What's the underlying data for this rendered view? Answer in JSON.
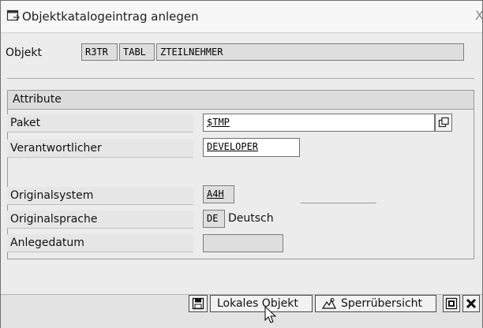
{
  "dialog": {
    "title": "Objektkatalogeintrag anlegen",
    "close_glyph": "X"
  },
  "object_row": {
    "label": "Objekt",
    "pgmid": "R3TR",
    "type": "TABL",
    "name": "ZTEILNEHMER"
  },
  "attributes": {
    "header": "Attribute",
    "paket_label": "Paket",
    "paket_value": "$TMP",
    "verantwortlicher_label": "Verantwortlicher",
    "verantwortlicher_value": "DEVELOPER",
    "originalsystem_label": "Originalsystem",
    "originalsystem_value": "A4H",
    "originalsprache_label": "Originalsprache",
    "originalsprache_code": "DE",
    "originalsprache_text": "Deutsch",
    "anlegedatum_label": "Anlegedatum",
    "anlegedatum_value": ""
  },
  "buttons": {
    "lokales_objekt": "Lokales Objekt",
    "sperruebersicht": "Sperrübersicht"
  },
  "icons": {
    "title": "dialog-icon",
    "save": "save-icon",
    "lock": "lock-overview-icon",
    "search_help": "search-help-icon",
    "help": "info-icon",
    "cancel": "cancel-icon"
  },
  "colors": {
    "dialog_bg": "#ececec",
    "group_header_bg": "#dcdcdc",
    "field_bg": "#ffffff",
    "readonly_bg": "#dedede"
  }
}
